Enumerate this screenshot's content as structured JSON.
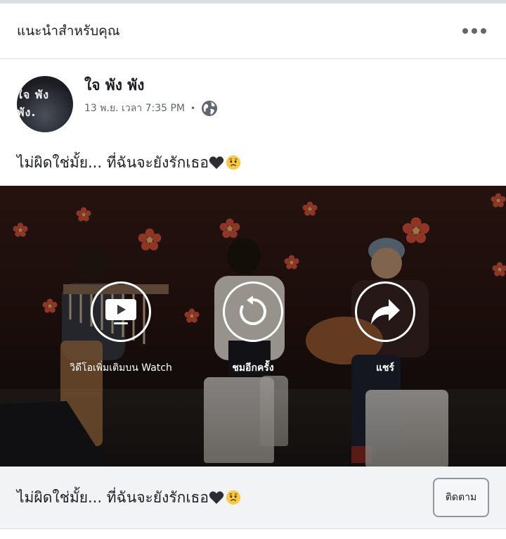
{
  "section": {
    "title": "แนะนำสำหรับคุณ"
  },
  "post": {
    "author": "ใจ พัง พัง",
    "avatar_text": "ใจ พัง พัง.",
    "timestamp": "13 พ.ย. เวลา 7:35 PM",
    "separator": "•",
    "text": "ไม่ผิดใช่มั้ย... ที่ฉันจะยังรักเธอ",
    "emoji": [
      "black-heart-icon",
      "worried-face-icon"
    ]
  },
  "video": {
    "actions": [
      {
        "label": "วิดีโอเพิ่มเติมบน Watch",
        "icon": "tv-play-icon"
      },
      {
        "label": "ชมอีกครั้ง",
        "icon": "replay-icon"
      },
      {
        "label": "แชร์",
        "icon": "share-arrow-icon"
      }
    ]
  },
  "footer": {
    "text": "ไม่ผิดใช่มั้ย... ที่ฉันจะยังรักเธอ",
    "follow_label": "ติดตาม"
  },
  "colors": {
    "text": "#1c1e21",
    "secondary": "#606770",
    "divider": "#dadde1",
    "footer_bg": "#f2f3f5"
  }
}
